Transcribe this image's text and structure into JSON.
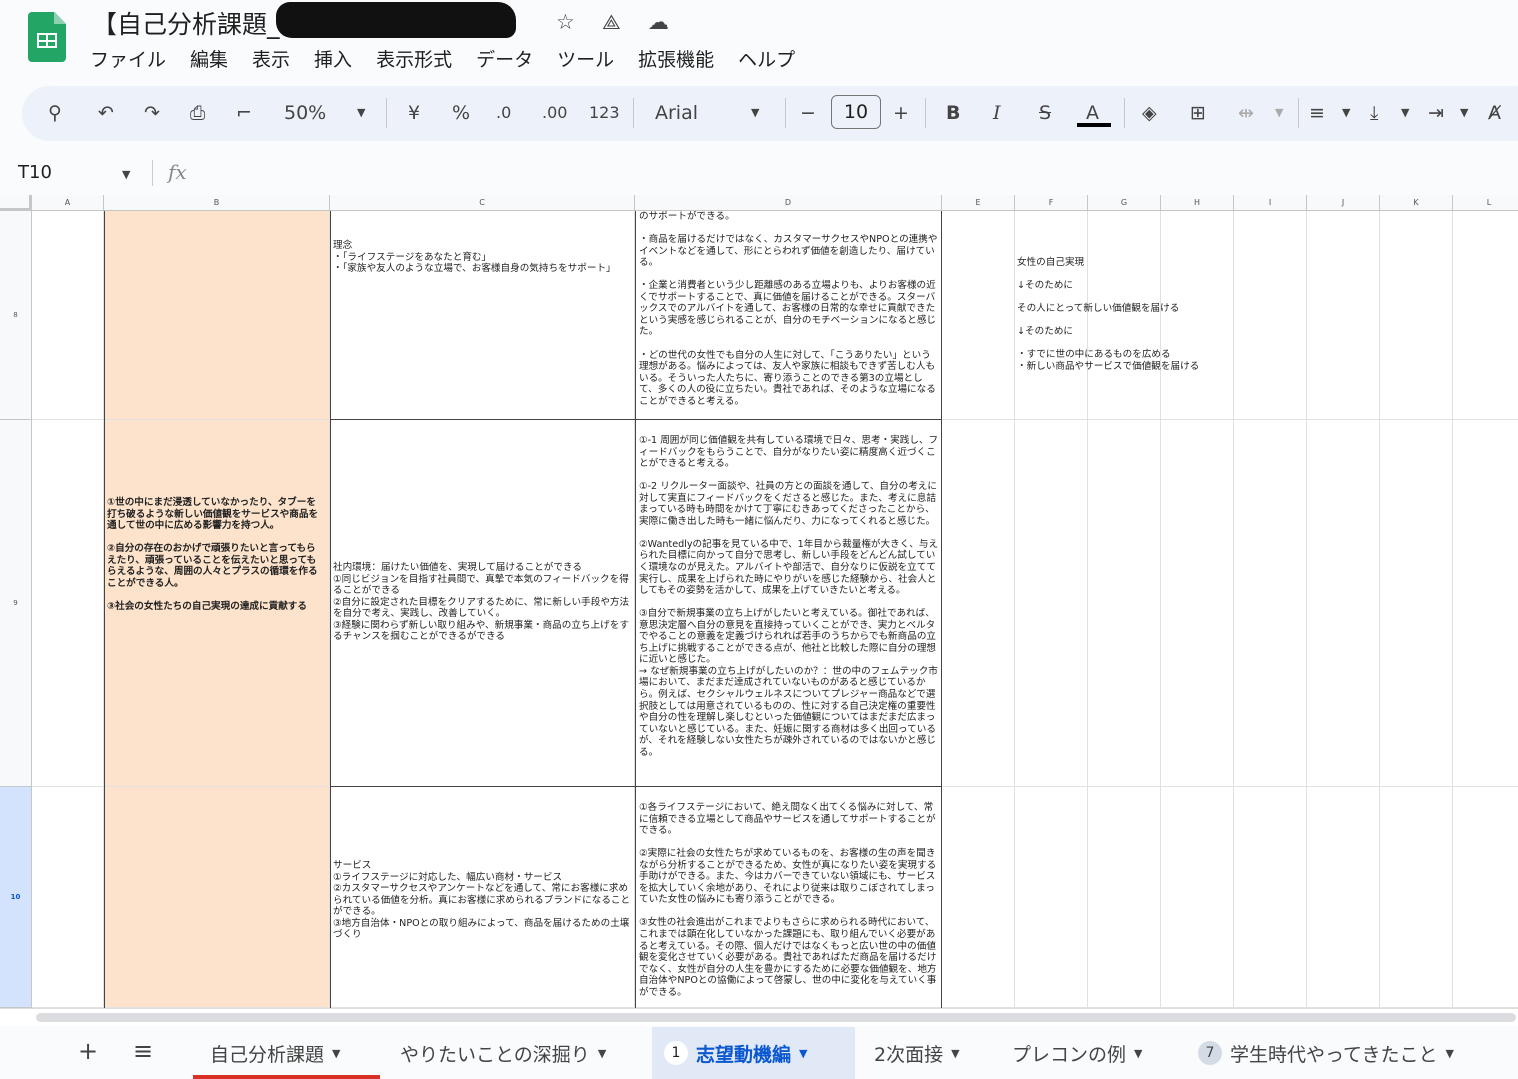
{
  "doc": {
    "title": "【自己分析課題_"
  },
  "menu": [
    "ファイル",
    "編集",
    "表示",
    "挿入",
    "表示形式",
    "データ",
    "ツール",
    "拡張機能",
    "ヘルプ"
  ],
  "toolbar": {
    "zoom": "50%",
    "currency": "¥",
    "percent": "%",
    "dec_decrease": ".0",
    "dec_increase": ".00",
    "number_format": "123",
    "font": "Arial",
    "font_size": "10",
    "minus": "−",
    "plus": "+",
    "bold": "B",
    "italic": "I",
    "strike": "S",
    "text_color": "A"
  },
  "formula": {
    "cell_ref": "T10",
    "fx": "fx",
    "value": ""
  },
  "columns": [
    "A",
    "B",
    "C",
    "D",
    "E",
    "F",
    "G",
    "H",
    "I",
    "J",
    "K",
    "L"
  ],
  "rows": [
    "8",
    "9",
    "10"
  ],
  "cells": {
    "B": "①世の中にまだ浸透していなかったり、タブーを打ち破るような新しい価値観をサービスや商品を通して世の中に広める影響力を持つ人。\n\n②自分の存在のおかげで頑張りたいと言ってもらえたり、頑張っていることを伝えたいと思ってもらえるような、周囲の人々とプラスの循環を作ることができる人。\n\n③社会の女性たちの自己実現の達成に貢献する",
    "C8": "理念\n・「ライフステージをあなたと育む」\n・「家族や友人のような立場で、お客様自身の気持ちをサポート」",
    "D8": "のサポートができる。\n\n・商品を届けるだけではなく、カスタマーサクセスやNPOとの連携やイベントなどを通して、形にとらわれず価値を創造したり、届けている。\n\n・企業と消費者という少し距離感のある立場よりも、よりお客様の近くでサポートすることで、真に価値を届けることができる。スターバックスでのアルバイトを通して、お客様の日常的な幸せに貢献できたという実感を感じられることが、自分のモチベーションになると感じた。\n\n・どの世代の女性でも自分の人生に対して、「こうありたい」という理想がある。悩みによっては、友人や家族に相談もできず苦しむ人もいる。そういった人たちに、寄り添うことのできる第3の立場として、多くの人の役に立ちたい。貴社であれば、そのような立場になることができると考える。",
    "F8": "女性の自己実現\n\n↓そのために\n\nその人にとって新しい価値観を届ける\n\n↓そのために\n\n・すでに世の中にあるものを広める\n・新しい商品やサービスで価値観を届ける",
    "C9": "社内環境：届けたい価値を、実現して届けることができる\n①同じビジョンを目指す社員間で、真摯で本気のフィードバックを得ることができる\n②自分に設定された目標をクリアするために、常に新しい手段や方法を自分で考え、実践し、改善していく。\n③経験に関わらず新しい取り組みや、新規事業・商品の立ち上げをするチャンスを掴むことができるができる",
    "D9": "①-1 周囲が同じ価値観を共有している環境で日々、思考・実践し、フィードバックをもらうことで、自分がなりたい姿に精度高く近づくことができると考える。\n\n①-2 リクルーター面談や、社員の方との面談を通して、自分の考えに対して実直にフィードバックをくださると感じた。また、考えに息詰まっている時も時間をかけて丁寧にむきあってくださったことから、実際に働き出した時も一緒に悩んだり、力になってくれると感じた。\n\n②Wantedlyの記事を見ている中で、1年目から裁量権が大きく、与えられた目標に向かって自分で思考し、新しい手段をどんどん試していく環境なのが見えた。アルバイトや部活で、自分なりに仮説を立てて実行し、成果を上げられた時にやりがいを感じた経験から、社会人としてもその姿勢を活かして、成果を上げていきたいと考える。\n\n③自分で新規事業の立ち上げがしたいと考えている。御社であれば、意思決定層へ自分の意見を直接持っていくことができ、実力とベルタでやることの意義を定義づけられれば若手のうちからでも新商品の立ち上げに挑戦することができる点が、他社と比較した際に自分の理想に近いと感じた。\n→ なぜ新規事業の立ち上げがしたいのか？：世の中のフェムテック市場において、まだまだ達成されていないものがあると感じているから。例えば、セクシャルウェルネスについてプレジャー商品などで選択肢としては用意されているものの、性に対する自己決定権の重要性や自分の性を理解し楽しむといった価値観についてはまだまだ広まっていないと感じている。また、妊娠に関する商材は多く出回っているが、それを経験しない女性たちが疎外されているのではないかと感じる。",
    "C10": "サービス\n①ライフステージに対応した、幅広い商材・サービス\n②カスタマーサクセスやアンケートなどを通して、常にお客様に求められている価値を分析。真にお客様に求められるブランドになることができる。\n③地方自治体・NPOとの取り組みによって、商品を届けるための土壌づくり",
    "D10": "①各ライフステージにおいて、絶え間なく出てくる悩みに対して、常に信頼できる立場として商品やサービスを通してサポートすることができる。\n\n②実際に社会の女性たちが求めているものを、お客様の生の声を聞きながら分析することができるため、女性が真になりたい姿を実現する手助けができる。また、今はカバーできていない領域にも、サービスを拡大していく余地があり、それにより従来は取りこぼされてしまっていた女性の悩みにも寄り添うことができる。\n\n③女性の社会進出がこれまでよりもさらに求められる時代において、これまでは顕在化していなかった課題にも、取り組んでいく必要があると考えている。その際、個人だけではなくもっと広い世の中の価値観を変化させていく必要がある。貴社であればただ商品を届けるだけでなく、女性が自分の人生を豊かにするために必要な価値観を、地方自治体やNPOとの協働によって啓蒙し、世の中に変化を与えていく事ができる。"
  },
  "tabs": [
    {
      "label": "自己分析課題",
      "badge": null
    },
    {
      "label": "やりたいことの深掘り",
      "badge": null
    },
    {
      "label": "志望動機編",
      "badge": "1",
      "active": true
    },
    {
      "label": "2次面接",
      "badge": null
    },
    {
      "label": "プレコンの例",
      "badge": null
    },
    {
      "label": "学生時代やってきたこと",
      "badge": "7"
    }
  ],
  "tabbar": {
    "add": "+",
    "all_sheets": "≡"
  },
  "colors": {
    "accent": "#0b57d0",
    "merged_fill": "#fde3cc",
    "selected_row": "#d3e3fd",
    "active_tab": "#e1e9f7",
    "sheets_green": "#23a566"
  }
}
